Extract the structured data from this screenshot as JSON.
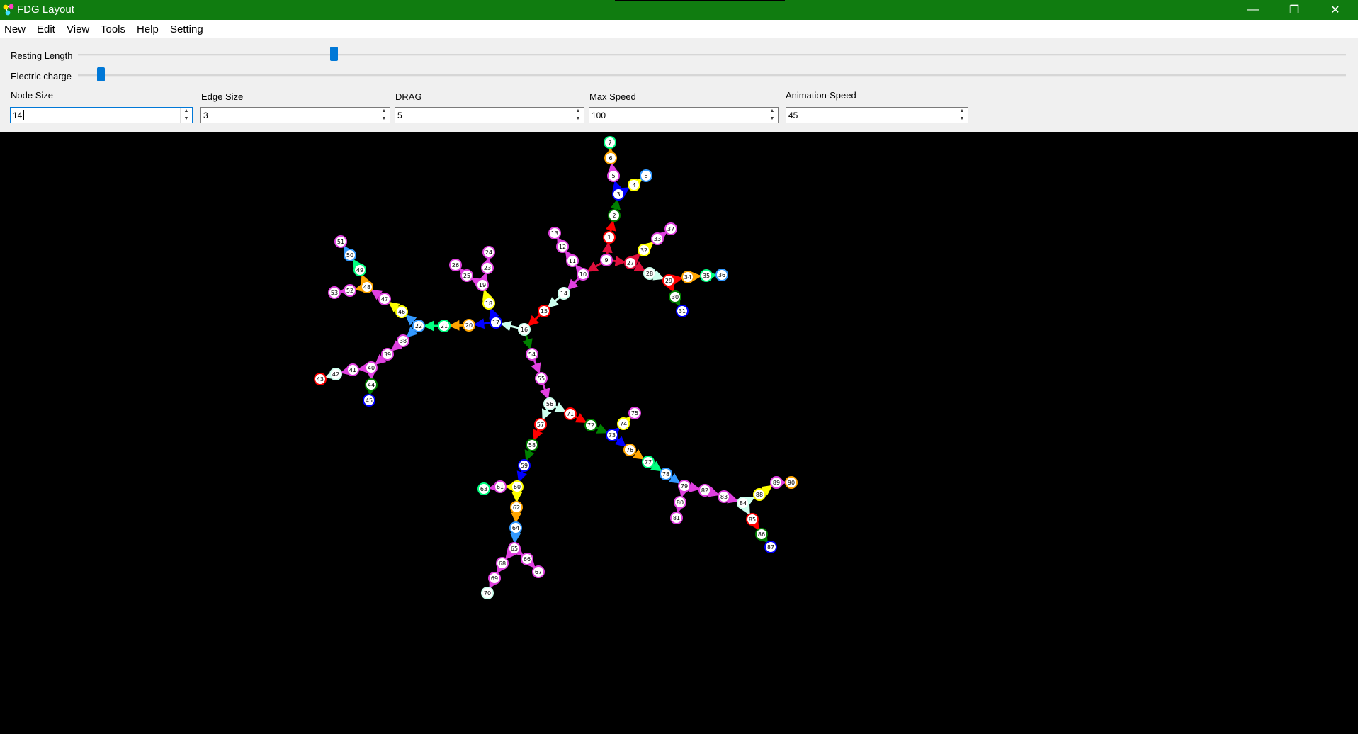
{
  "titlebar": {
    "title": "FDG Layout",
    "minimize_glyph": "—",
    "maximize_glyph": "❐",
    "close_glyph": "✕"
  },
  "menu": [
    "New",
    "Edit",
    "View",
    "Tools",
    "Help",
    "Setting"
  ],
  "sliders": {
    "resting_length": {
      "label": "Resting Length",
      "value": 0.2
    },
    "electric_charge": {
      "label": "Electric charge",
      "value": 0.015
    }
  },
  "fields": {
    "node_size": {
      "label": "Node Size",
      "value": "14"
    },
    "edge_size": {
      "label": "Edge Size",
      "value": "3"
    },
    "drag": {
      "label": "DRAG",
      "value": "5"
    },
    "max_speed": {
      "label": "Max Speed",
      "value": "100"
    },
    "animation_speed": {
      "label": "Animation-Speed",
      "value": "45"
    }
  },
  "colors": {
    "titlebar": "#107c10",
    "canvas": "#000000",
    "node_fill": "#ffffff",
    "accent": "#0078d7",
    "palette": {
      "red": "#ff0000",
      "crimson": "#e0103c",
      "magenta": "#e040e0",
      "orange": "#ffa500",
      "yellow": "#ffff00",
      "green": "#008000",
      "mint": "#00ff80",
      "sky": "#3399ff",
      "blue": "#0000ff",
      "pale": "#ccffee",
      "maroon": "#a00030"
    }
  },
  "graph": {
    "nodes": [
      {
        "id": "1",
        "c": "red"
      },
      {
        "id": "2",
        "c": "green"
      },
      {
        "id": "3",
        "c": "blue"
      },
      {
        "id": "4",
        "c": "yellow"
      },
      {
        "id": "5",
        "c": "magenta"
      },
      {
        "id": "6",
        "c": "orange"
      },
      {
        "id": "7",
        "c": "mint"
      },
      {
        "id": "8",
        "c": "sky"
      },
      {
        "id": "9",
        "c": "magenta"
      },
      {
        "id": "10",
        "c": "magenta"
      },
      {
        "id": "11",
        "c": "magenta"
      },
      {
        "id": "12",
        "c": "magenta"
      },
      {
        "id": "13",
        "c": "magenta"
      },
      {
        "id": "14",
        "c": "pale"
      },
      {
        "id": "15",
        "c": "red"
      },
      {
        "id": "16",
        "c": "pale"
      },
      {
        "id": "17",
        "c": "blue"
      },
      {
        "id": "18",
        "c": "yellow"
      },
      {
        "id": "19",
        "c": "magenta"
      },
      {
        "id": "20",
        "c": "orange"
      },
      {
        "id": "21",
        "c": "mint"
      },
      {
        "id": "22",
        "c": "sky"
      },
      {
        "id": "23",
        "c": "magenta"
      },
      {
        "id": "24",
        "c": "magenta"
      },
      {
        "id": "25",
        "c": "magenta"
      },
      {
        "id": "26",
        "c": "magenta"
      },
      {
        "id": "27",
        "c": "crimson"
      },
      {
        "id": "28",
        "c": "pale"
      },
      {
        "id": "29",
        "c": "red"
      },
      {
        "id": "30",
        "c": "green"
      },
      {
        "id": "31",
        "c": "blue"
      },
      {
        "id": "32",
        "c": "yellow"
      },
      {
        "id": "33",
        "c": "magenta"
      },
      {
        "id": "34",
        "c": "orange"
      },
      {
        "id": "35",
        "c": "mint"
      },
      {
        "id": "36",
        "c": "sky"
      },
      {
        "id": "37",
        "c": "magenta"
      },
      {
        "id": "38",
        "c": "magenta"
      },
      {
        "id": "39",
        "c": "magenta"
      },
      {
        "id": "40",
        "c": "magenta"
      },
      {
        "id": "41",
        "c": "magenta"
      },
      {
        "id": "42",
        "c": "pale"
      },
      {
        "id": "43",
        "c": "red"
      },
      {
        "id": "44",
        "c": "green"
      },
      {
        "id": "45",
        "c": "blue"
      },
      {
        "id": "46",
        "c": "yellow"
      },
      {
        "id": "47",
        "c": "magenta"
      },
      {
        "id": "48",
        "c": "orange"
      },
      {
        "id": "49",
        "c": "mint"
      },
      {
        "id": "50",
        "c": "sky"
      },
      {
        "id": "51",
        "c": "magenta"
      },
      {
        "id": "52",
        "c": "magenta"
      },
      {
        "id": "53",
        "c": "magenta"
      },
      {
        "id": "54",
        "c": "magenta"
      },
      {
        "id": "55",
        "c": "magenta"
      },
      {
        "id": "56",
        "c": "pale"
      },
      {
        "id": "57",
        "c": "red"
      },
      {
        "id": "58",
        "c": "green"
      },
      {
        "id": "59",
        "c": "blue"
      },
      {
        "id": "60",
        "c": "yellow"
      },
      {
        "id": "61",
        "c": "magenta"
      },
      {
        "id": "62",
        "c": "orange"
      },
      {
        "id": "63",
        "c": "mint"
      },
      {
        "id": "64",
        "c": "sky"
      },
      {
        "id": "65",
        "c": "magenta"
      },
      {
        "id": "66",
        "c": "magenta"
      },
      {
        "id": "67",
        "c": "magenta"
      },
      {
        "id": "68",
        "c": "magenta"
      },
      {
        "id": "69",
        "c": "magenta"
      },
      {
        "id": "70",
        "c": "pale"
      },
      {
        "id": "71",
        "c": "red"
      },
      {
        "id": "72",
        "c": "green"
      },
      {
        "id": "73",
        "c": "blue"
      },
      {
        "id": "74",
        "c": "yellow"
      },
      {
        "id": "75",
        "c": "magenta"
      },
      {
        "id": "76",
        "c": "orange"
      },
      {
        "id": "77",
        "c": "mint"
      },
      {
        "id": "78",
        "c": "sky"
      },
      {
        "id": "79",
        "c": "magenta"
      },
      {
        "id": "80",
        "c": "magenta"
      },
      {
        "id": "81",
        "c": "magenta"
      },
      {
        "id": "82",
        "c": "magenta"
      },
      {
        "id": "83",
        "c": "magenta"
      },
      {
        "id": "84",
        "c": "pale"
      },
      {
        "id": "85",
        "c": "red"
      },
      {
        "id": "86",
        "c": "green"
      },
      {
        "id": "87",
        "c": "blue"
      },
      {
        "id": "88",
        "c": "yellow"
      },
      {
        "id": "89",
        "c": "magenta"
      },
      {
        "id": "90",
        "c": "orange"
      }
    ],
    "edges": [
      {
        "from": "9",
        "to": "1",
        "c": "crimson"
      },
      {
        "from": "1",
        "to": "2",
        "c": "red"
      },
      {
        "from": "2",
        "to": "3",
        "c": "green"
      },
      {
        "from": "3",
        "to": "4",
        "c": "blue"
      },
      {
        "from": "4",
        "to": "8",
        "c": "yellow"
      },
      {
        "from": "3",
        "to": "5",
        "c": "blue"
      },
      {
        "from": "5",
        "to": "6",
        "c": "magenta"
      },
      {
        "from": "6",
        "to": "7",
        "c": "orange"
      },
      {
        "from": "9",
        "to": "10",
        "c": "crimson"
      },
      {
        "from": "10",
        "to": "11",
        "c": "magenta"
      },
      {
        "from": "11",
        "to": "12",
        "c": "magenta"
      },
      {
        "from": "12",
        "to": "13",
        "c": "magenta"
      },
      {
        "from": "10",
        "to": "14",
        "c": "magenta"
      },
      {
        "from": "14",
        "to": "15",
        "c": "pale"
      },
      {
        "from": "15",
        "to": "16",
        "c": "red"
      },
      {
        "from": "16",
        "to": "17",
        "c": "pale"
      },
      {
        "from": "17",
        "to": "18",
        "c": "blue"
      },
      {
        "from": "18",
        "to": "19",
        "c": "yellow"
      },
      {
        "from": "19",
        "to": "23",
        "c": "magenta"
      },
      {
        "from": "23",
        "to": "24",
        "c": "magenta"
      },
      {
        "from": "19",
        "to": "25",
        "c": "magenta"
      },
      {
        "from": "25",
        "to": "26",
        "c": "magenta"
      },
      {
        "from": "17",
        "to": "20",
        "c": "blue"
      },
      {
        "from": "20",
        "to": "21",
        "c": "orange"
      },
      {
        "from": "21",
        "to": "22",
        "c": "mint"
      },
      {
        "from": "22",
        "to": "46",
        "c": "sky"
      },
      {
        "from": "46",
        "to": "47",
        "c": "yellow"
      },
      {
        "from": "47",
        "to": "48",
        "c": "magenta"
      },
      {
        "from": "48",
        "to": "52",
        "c": "orange"
      },
      {
        "from": "52",
        "to": "53",
        "c": "magenta"
      },
      {
        "from": "48",
        "to": "49",
        "c": "orange"
      },
      {
        "from": "49",
        "to": "50",
        "c": "mint"
      },
      {
        "from": "50",
        "to": "51",
        "c": "sky"
      },
      {
        "from": "22",
        "to": "38",
        "c": "sky"
      },
      {
        "from": "38",
        "to": "39",
        "c": "magenta"
      },
      {
        "from": "39",
        "to": "40",
        "c": "magenta"
      },
      {
        "from": "40",
        "to": "41",
        "c": "magenta"
      },
      {
        "from": "41",
        "to": "42",
        "c": "magenta"
      },
      {
        "from": "42",
        "to": "43",
        "c": "pale"
      },
      {
        "from": "40",
        "to": "44",
        "c": "magenta"
      },
      {
        "from": "44",
        "to": "45",
        "c": "green"
      },
      {
        "from": "9",
        "to": "27",
        "c": "crimson"
      },
      {
        "from": "27",
        "to": "28",
        "c": "crimson"
      },
      {
        "from": "28",
        "to": "29",
        "c": "pale"
      },
      {
        "from": "29",
        "to": "30",
        "c": "red"
      },
      {
        "from": "30",
        "to": "31",
        "c": "green"
      },
      {
        "from": "29",
        "to": "34",
        "c": "red"
      },
      {
        "from": "34",
        "to": "35",
        "c": "orange"
      },
      {
        "from": "35",
        "to": "36",
        "c": "mint"
      },
      {
        "from": "27",
        "to": "32",
        "c": "crimson"
      },
      {
        "from": "32",
        "to": "33",
        "c": "yellow"
      },
      {
        "from": "33",
        "to": "37",
        "c": "magenta"
      },
      {
        "from": "16",
        "to": "54",
        "c": "green"
      },
      {
        "from": "54",
        "to": "55",
        "c": "magenta"
      },
      {
        "from": "55",
        "to": "56",
        "c": "magenta"
      },
      {
        "from": "56",
        "to": "57",
        "c": "pale"
      },
      {
        "from": "57",
        "to": "58",
        "c": "red"
      },
      {
        "from": "58",
        "to": "59",
        "c": "green"
      },
      {
        "from": "59",
        "to": "60",
        "c": "blue"
      },
      {
        "from": "60",
        "to": "61",
        "c": "yellow"
      },
      {
        "from": "61",
        "to": "63",
        "c": "magenta"
      },
      {
        "from": "60",
        "to": "62",
        "c": "yellow"
      },
      {
        "from": "62",
        "to": "64",
        "c": "orange"
      },
      {
        "from": "64",
        "to": "65",
        "c": "sky"
      },
      {
        "from": "65",
        "to": "66",
        "c": "magenta"
      },
      {
        "from": "66",
        "to": "67",
        "c": "magenta"
      },
      {
        "from": "65",
        "to": "68",
        "c": "magenta"
      },
      {
        "from": "68",
        "to": "69",
        "c": "magenta"
      },
      {
        "from": "69",
        "to": "70",
        "c": "magenta"
      },
      {
        "from": "56",
        "to": "71",
        "c": "pale"
      },
      {
        "from": "71",
        "to": "72",
        "c": "red"
      },
      {
        "from": "72",
        "to": "73",
        "c": "green"
      },
      {
        "from": "73",
        "to": "74",
        "c": "blue"
      },
      {
        "from": "74",
        "to": "75",
        "c": "yellow"
      },
      {
        "from": "73",
        "to": "76",
        "c": "blue"
      },
      {
        "from": "76",
        "to": "77",
        "c": "orange"
      },
      {
        "from": "77",
        "to": "78",
        "c": "mint"
      },
      {
        "from": "78",
        "to": "79",
        "c": "sky"
      },
      {
        "from": "79",
        "to": "80",
        "c": "magenta"
      },
      {
        "from": "80",
        "to": "81",
        "c": "magenta"
      },
      {
        "from": "79",
        "to": "82",
        "c": "magenta"
      },
      {
        "from": "82",
        "to": "83",
        "c": "magenta"
      },
      {
        "from": "83",
        "to": "84",
        "c": "magenta"
      },
      {
        "from": "84",
        "to": "85",
        "c": "pale"
      },
      {
        "from": "85",
        "to": "86",
        "c": "red"
      },
      {
        "from": "86",
        "to": "87",
        "c": "green"
      },
      {
        "from": "84",
        "to": "88",
        "c": "pale"
      },
      {
        "from": "88",
        "to": "89",
        "c": "yellow"
      },
      {
        "from": "89",
        "to": "90",
        "c": "magenta"
      }
    ]
  }
}
